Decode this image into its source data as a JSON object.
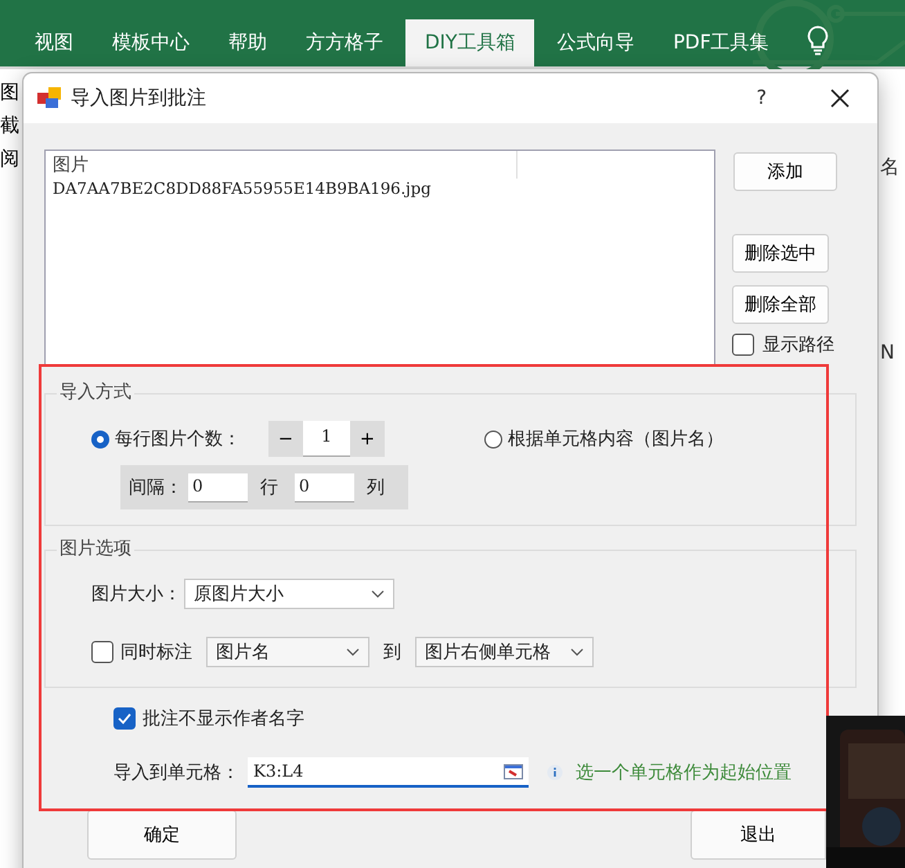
{
  "ribbon": {
    "tabs": [
      {
        "label": "视图",
        "selected": false
      },
      {
        "label": "模板中心",
        "selected": false
      },
      {
        "label": "帮助",
        "selected": false
      },
      {
        "label": "方方格子",
        "selected": false
      },
      {
        "label": "DIY工具箱",
        "selected": true
      },
      {
        "label": "公式向导",
        "selected": false
      },
      {
        "label": "PDF工具集",
        "selected": false
      }
    ]
  },
  "sheet": {
    "left_fragments": [
      "图",
      "截",
      "阅"
    ],
    "right_fragments": [
      "名",
      "N"
    ]
  },
  "dialog": {
    "title": "导入图片到批注",
    "help": "?",
    "list": {
      "column": "图片",
      "items": [
        "DA7AA7BE2C8DD88FA55955E14B9BA196.jpg"
      ]
    },
    "buttons": [
      "添加",
      "删除选中",
      "删除全部"
    ],
    "show_path": {
      "label": "显示路径",
      "checked": false
    },
    "import_mode": {
      "title": "导入方式",
      "options": [
        {
          "label": "每行图片个数：",
          "selected": true
        },
        {
          "label": "根据单元格内容（图片名）",
          "selected": false
        }
      ],
      "stepper": {
        "minus": "−",
        "value": "1",
        "plus": "+"
      },
      "spacing": {
        "label": "间隔：",
        "rows": "0",
        "rows_unit": "行",
        "cols": "0",
        "cols_unit": "列"
      }
    },
    "picture_options": {
      "title": "图片选项",
      "size_label": "图片大小：",
      "size_value": "原图片大小",
      "annotate": {
        "label": "同时标注",
        "checked": false,
        "field": "图片名",
        "to": "到",
        "target": "图片右侧单元格"
      }
    },
    "hide_author": {
      "label": "批注不显示作者名字",
      "checked": true
    },
    "target_cell": {
      "label": "导入到单元格：",
      "value": "K3:L4",
      "hint": "选一个单元格作为起始位置"
    },
    "actions": [
      "确定",
      "退出"
    ]
  }
}
